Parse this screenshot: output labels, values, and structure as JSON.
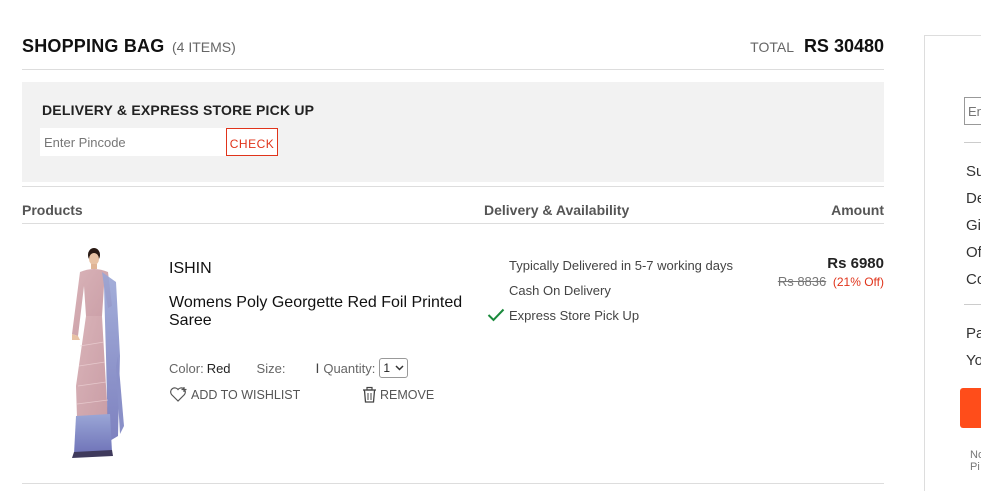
{
  "header": {
    "title": "SHOPPING BAG",
    "item_count": "(4 ITEMS)",
    "total_label": "TOTAL",
    "total_value": "RS 30480"
  },
  "delivery": {
    "title": "DELIVERY & EXPRESS STORE PICK UP",
    "pincode_placeholder": "Enter Pincode",
    "check_label": "CHECK"
  },
  "columns": {
    "products": "Products",
    "delivery": "Delivery & Availability",
    "amount": "Amount"
  },
  "product": {
    "brand": "ISHIN",
    "name": "Womens Poly Georgette Red Foil Printed Saree",
    "color_label": "Color:",
    "color_value": "Red",
    "size_label": "Size:",
    "separator": "I",
    "quantity_label": "Quantity:",
    "quantity_value": "1",
    "wishlist_label": "ADD TO WISHLIST",
    "remove_label": "REMOVE",
    "delivery_info": [
      "Typically Delivered in 5-7 working days",
      "Cash On Delivery",
      "Express Store Pick Up"
    ],
    "price": "Rs 6980",
    "mrp": "Rs 8836",
    "discount": "(21% Off)"
  },
  "summary": {
    "coupon_placeholder": "En",
    "lines": [
      "Su",
      "De",
      "Gi",
      "Of",
      "Co"
    ],
    "lines2": [
      "Pa",
      "Yo"
    ],
    "note": [
      "No",
      "Pi"
    ]
  },
  "colors": {
    "accent": "#e0341b",
    "checkout_button": "#ff4d1a",
    "check_green": "#1a8a3c",
    "panel_gray": "#f2f2f2"
  }
}
